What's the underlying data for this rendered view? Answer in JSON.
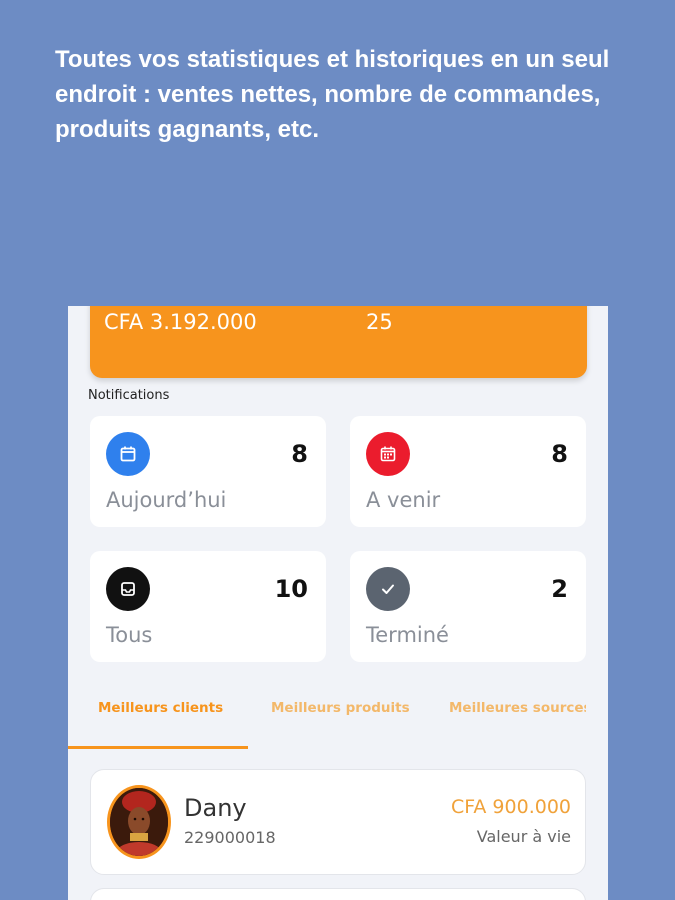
{
  "headline": "Toutes vos statistiques et historiques en un seul endroit : ventes nettes, nombre de commandes, produits gagnants, etc.",
  "summary": {
    "net_sales": "CFA 3.192.000",
    "orders": "25",
    "accent_color": "#f7941d"
  },
  "notifications": {
    "title": "Notifications",
    "cards": [
      {
        "label": "Aujourd’hui",
        "count": "8",
        "icon": "calendar-icon",
        "color": "#2f80ed"
      },
      {
        "label": "A venir",
        "count": "8",
        "icon": "calendar-grid-icon",
        "color": "#eb1c2d"
      },
      {
        "label": "Tous",
        "count": "10",
        "icon": "inbox-icon",
        "color": "#111111"
      },
      {
        "label": "Terminé",
        "count": "2",
        "icon": "check-icon",
        "color": "#5b6470"
      }
    ]
  },
  "tabs": [
    {
      "label": "Meilleurs clients",
      "active": true
    },
    {
      "label": "Meilleurs produits",
      "active": false
    },
    {
      "label": "Meilleures sources",
      "active": false
    }
  ],
  "clients": [
    {
      "name": "Dany",
      "phone": "229000018",
      "value": "CFA 900.000",
      "value_label": "Valeur à vie"
    }
  ]
}
